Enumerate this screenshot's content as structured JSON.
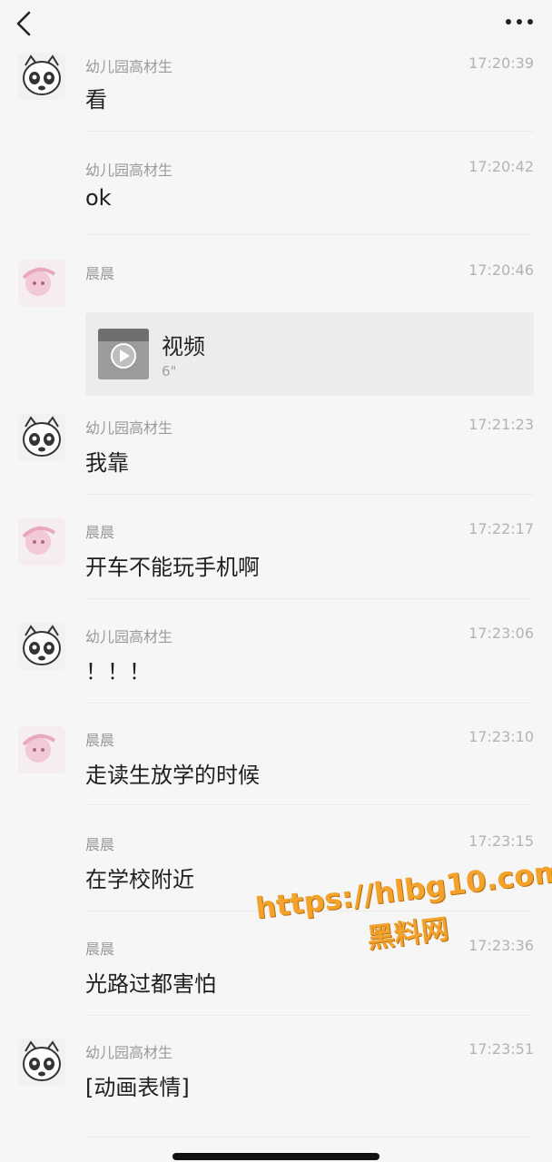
{
  "header": {
    "back_icon": "chevron-left-icon",
    "more_icon": "ellipsis-icon"
  },
  "messages": [
    {
      "sender": "幼儿园高材生",
      "time": "17:20:39",
      "text": "看",
      "avatar": "raccoon-avatar"
    },
    {
      "sender": "幼儿园高材生",
      "time": "17:20:42",
      "text": "ok"
    },
    {
      "sender": "晨晨",
      "time": "17:20:46",
      "avatar": "pink-avatar",
      "video": {
        "title": "视频",
        "duration": "6\""
      }
    },
    {
      "sender": "幼儿园高材生",
      "time": "17:21:23",
      "text": "我靠",
      "avatar": "raccoon-avatar"
    },
    {
      "sender": "晨晨",
      "time": "17:22:17",
      "text": "开车不能玩手机啊",
      "avatar": "pink-avatar"
    },
    {
      "sender": "幼儿园高材生",
      "time": "17:23:06",
      "text": "！！！",
      "avatar": "raccoon-avatar"
    },
    {
      "sender": "晨晨",
      "time": "17:23:10",
      "text": "走读生放学的时候",
      "avatar": "pink-avatar"
    },
    {
      "sender": "晨晨",
      "time": "17:23:15",
      "text": "在学校附近"
    },
    {
      "sender": "晨晨",
      "time": "17:23:36",
      "text": "光路过都害怕"
    },
    {
      "sender": "幼儿园高材生",
      "time": "17:23:51",
      "text": "[动画表情]",
      "avatar": "raccoon-avatar"
    }
  ],
  "watermark": {
    "url": "https://hlbg10.com",
    "name": "黑料网",
    "color": "#f3a22b"
  }
}
